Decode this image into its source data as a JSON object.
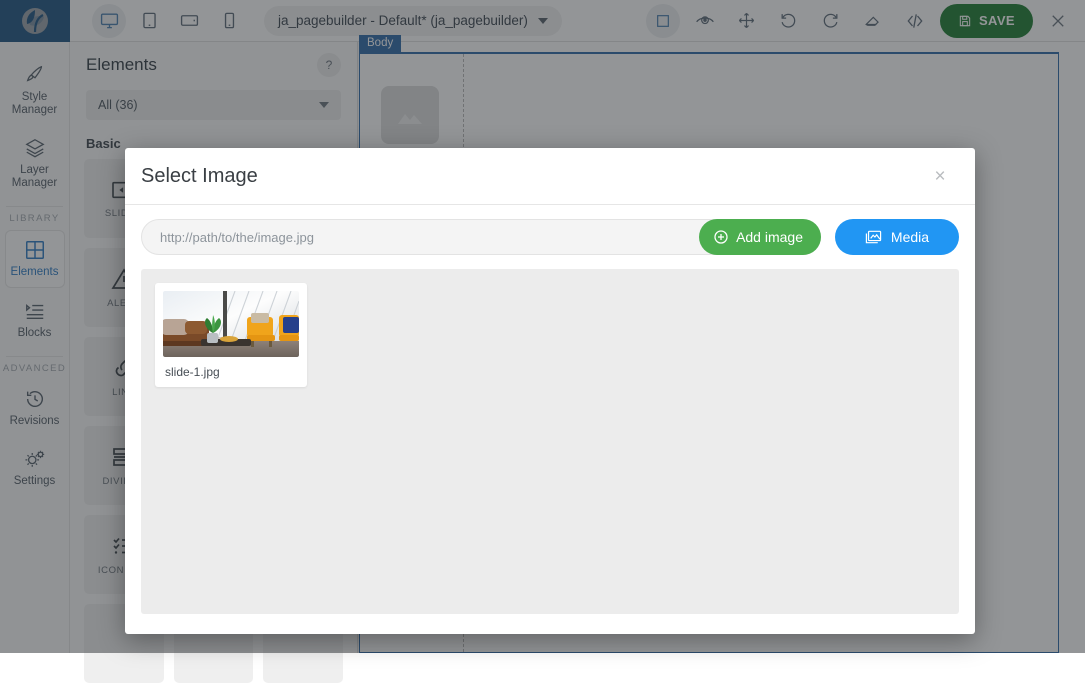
{
  "app": {
    "logo_icon": "leaf-logo-icon",
    "logo_color": "#1f5582",
    "accent_blue": "#2f6aa8",
    "save_color": "#1e7d32",
    "add_color": "#4cae4f",
    "media_color": "#2196f3"
  },
  "topbar": {
    "devices": [
      {
        "name": "desktop-view-button",
        "icon": "desktop-icon",
        "active": true
      },
      {
        "name": "tablet-view-button",
        "icon": "tablet-icon",
        "active": false
      },
      {
        "name": "landscape-view-button",
        "icon": "tablet-landscape-icon",
        "active": false
      },
      {
        "name": "mobile-view-button",
        "icon": "mobile-icon",
        "active": false
      }
    ],
    "page_select": "ja_pagebuilder - Default* (ja_pagebuilder)",
    "tools": [
      {
        "name": "borders-toggle-button",
        "icon": "square-outline-icon",
        "active": true
      },
      {
        "name": "preview-button",
        "icon": "eye-icon",
        "active": false
      },
      {
        "name": "fullscreen-button",
        "icon": "arrows-move-icon",
        "active": false
      },
      {
        "name": "undo-button",
        "icon": "undo-arrow-icon",
        "active": false
      },
      {
        "name": "redo-button",
        "icon": "redo-arrow-icon",
        "active": false
      },
      {
        "name": "clear-canvas-button",
        "icon": "eraser-icon",
        "active": false
      },
      {
        "name": "view-code-button",
        "icon": "code-brackets-icon",
        "active": false
      }
    ],
    "save_label": "SAVE",
    "save_icon": "floppy-disk-icon",
    "close_icon": "close-x-icon"
  },
  "rail": {
    "items": [
      {
        "label": "Style\nManager",
        "line1": "Style",
        "line2": "Manager",
        "icon": "paintbrush-icon",
        "selected": false
      },
      {
        "label": "Layer Manager",
        "line1": "Layer",
        "line2": "Manager",
        "icon": "layers-icon",
        "selected": false
      }
    ],
    "caption_library": "LIBRARY",
    "library": [
      {
        "line1": "Elements",
        "line2": "",
        "icon": "grid-squares-icon",
        "selected": true
      },
      {
        "line1": "Blocks",
        "line2": "",
        "icon": "blocks-list-icon",
        "selected": false
      }
    ],
    "caption_advanced": "ADVANCED",
    "advanced": [
      {
        "line1": "Revisions",
        "line2": "",
        "icon": "history-clock-icon",
        "selected": false
      },
      {
        "line1": "Settings",
        "line2": "",
        "icon": "gears-icon",
        "selected": false
      }
    ]
  },
  "panel": {
    "title": "Elements",
    "help_label": "?",
    "filter_value": "All (36)",
    "group_label": "Basic",
    "elements": [
      {
        "label": "SLIDER",
        "icon": "slider-arrow-icon"
      },
      {
        "label": "",
        "icon": ""
      },
      {
        "label": "",
        "icon": ""
      },
      {
        "label": "ALERT",
        "icon": "alert-triangle-icon"
      },
      {
        "label": "",
        "icon": ""
      },
      {
        "label": "",
        "icon": ""
      },
      {
        "label": "LINK",
        "icon": "chain-link-icon"
      },
      {
        "label": "",
        "icon": ""
      },
      {
        "label": "",
        "icon": ""
      },
      {
        "label": "DIVIDER",
        "icon": "divider-lines-icon"
      },
      {
        "label": "",
        "icon": ""
      },
      {
        "label": "",
        "icon": ""
      },
      {
        "label": "ICON LIST",
        "icon": "checklist-icon"
      },
      {
        "label": "",
        "icon": ""
      },
      {
        "label": "",
        "icon": ""
      },
      {
        "label": "",
        "icon": ""
      },
      {
        "label": "",
        "icon": ""
      },
      {
        "label": "",
        "icon": ""
      }
    ]
  },
  "canvas": {
    "body_tag": "Body",
    "placeholder_icon": "image-placeholder-icon"
  },
  "modal": {
    "title": "Select Image",
    "close_icon": "close-x-icon",
    "url_placeholder": "http://path/to/the/image.jpg",
    "url_value": "",
    "add_label": "Add image",
    "add_icon": "plus-circle-icon",
    "media_label": "Media",
    "media_icon": "media-images-icon",
    "assets": [
      {
        "name": "slide-1.jpg"
      }
    ]
  }
}
